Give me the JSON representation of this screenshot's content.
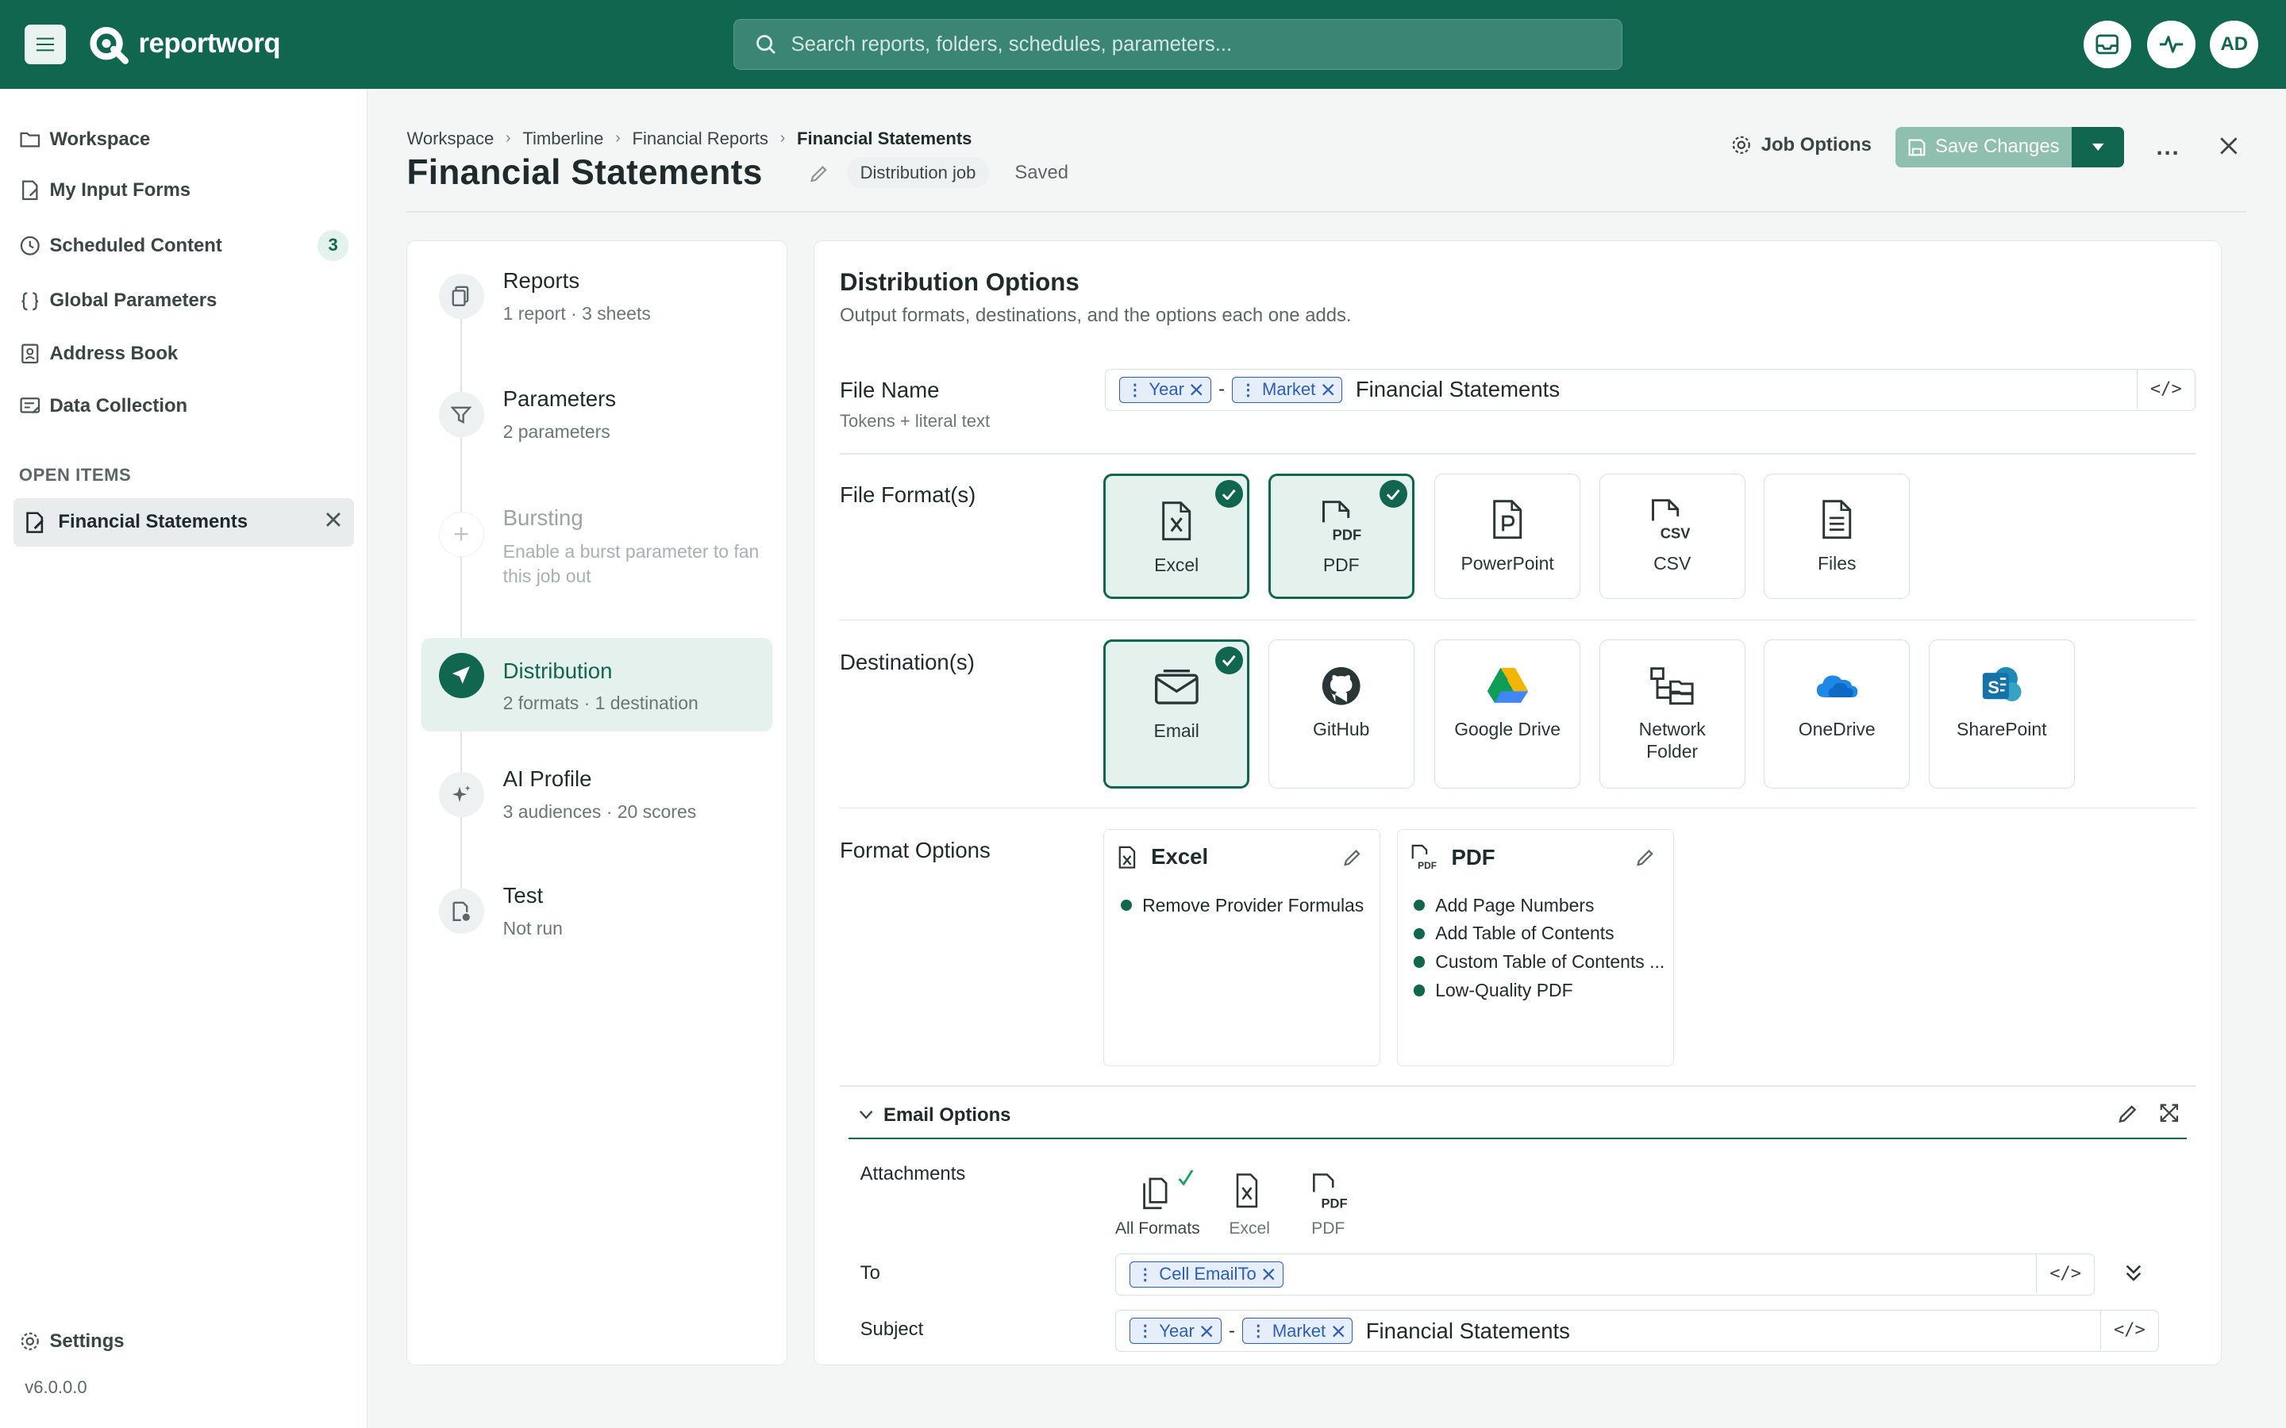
{
  "brand": {
    "name": "reportworq"
  },
  "search": {
    "placeholder": "Search reports, folders, schedules, parameters..."
  },
  "user": {
    "initials": "AD"
  },
  "sidebar": {
    "items": [
      {
        "label": "Workspace",
        "icon": "folder-icon"
      },
      {
        "label": "My Input Forms",
        "icon": "form-icon"
      },
      {
        "label": "Scheduled Content",
        "icon": "clock-icon",
        "badge": "3"
      },
      {
        "label": "Global Parameters",
        "icon": "braces-icon"
      },
      {
        "label": "Address Book",
        "icon": "address-book-icon"
      },
      {
        "label": "Data Collection",
        "icon": "data-collection-icon"
      }
    ],
    "open_items_title": "OPEN ITEMS",
    "open_item": "Financial Statements",
    "settings_label": "Settings",
    "version": "v6.0.0.0"
  },
  "breadcrumb": [
    "Workspace",
    "Timberline",
    "Financial Reports",
    "Financial Statements"
  ],
  "header": {
    "title": "Financial Statements",
    "job_type": "Distribution job",
    "status": "Saved",
    "job_options": "Job Options",
    "save_label": "Save Changes",
    "more": "..."
  },
  "steps": [
    {
      "title": "Reports",
      "sub": "1 report · 3 sheets",
      "state": "normal"
    },
    {
      "title": "Parameters",
      "sub": "2 parameters",
      "state": "normal"
    },
    {
      "title": "Bursting",
      "sub": "Enable a burst parameter to fan this job out",
      "state": "disabled"
    },
    {
      "title": "Distribution",
      "sub": "2 formats · 1 destination",
      "state": "active"
    },
    {
      "title": "AI Profile",
      "sub": "3 audiences · 20 scores",
      "state": "normal"
    },
    {
      "title": "Test",
      "sub": "Not run",
      "state": "normal"
    }
  ],
  "distribution": {
    "title": "Distribution Options",
    "subtitle": "Output formats, destinations, and the options each one adds.",
    "file_name_label": "File Name",
    "file_name_sub": "Tokens + literal text",
    "file_name_tokens": [
      "Year",
      "Market"
    ],
    "file_name_separator": "-",
    "file_name_literal": "Financial Statements",
    "formats_label": "File Format(s)",
    "formats": [
      {
        "label": "Excel",
        "selected": true
      },
      {
        "label": "PDF",
        "selected": true
      },
      {
        "label": "PowerPoint",
        "selected": false
      },
      {
        "label": "CSV",
        "selected": false
      },
      {
        "label": "Files",
        "selected": false
      }
    ],
    "destinations_label": "Destination(s)",
    "destinations": [
      {
        "label": "Email",
        "selected": true
      },
      {
        "label": "GitHub",
        "selected": false
      },
      {
        "label": "Google Drive",
        "selected": false
      },
      {
        "label": "Network Folder",
        "selected": false
      },
      {
        "label": "OneDrive",
        "selected": false
      },
      {
        "label": "SharePoint",
        "selected": false
      }
    ],
    "format_options_label": "Format Options",
    "format_options": [
      {
        "name": "Excel",
        "options": [
          "Remove Provider Formulas"
        ]
      },
      {
        "name": "PDF",
        "options": [
          "Add Page Numbers",
          "Add Table of Contents",
          "Custom Table of Contents ...",
          "Low-Quality PDF"
        ]
      }
    ]
  },
  "email": {
    "title": "Email Options",
    "attachments_label": "Attachments",
    "attachments": [
      {
        "label": "All Formats",
        "selected": true
      },
      {
        "label": "Excel",
        "selected": false
      },
      {
        "label": "PDF",
        "selected": false
      }
    ],
    "to_label": "To",
    "to_tokens": [
      "Cell EmailTo"
    ],
    "subject_label": "Subject",
    "subject_tokens": [
      "Year",
      "Market"
    ],
    "subject_separator": "-",
    "subject_literal": "Financial Statements"
  },
  "colors": {
    "brand": "#11664f",
    "token": "#2d5fb7",
    "selected_bg": "#e4f1ec"
  }
}
